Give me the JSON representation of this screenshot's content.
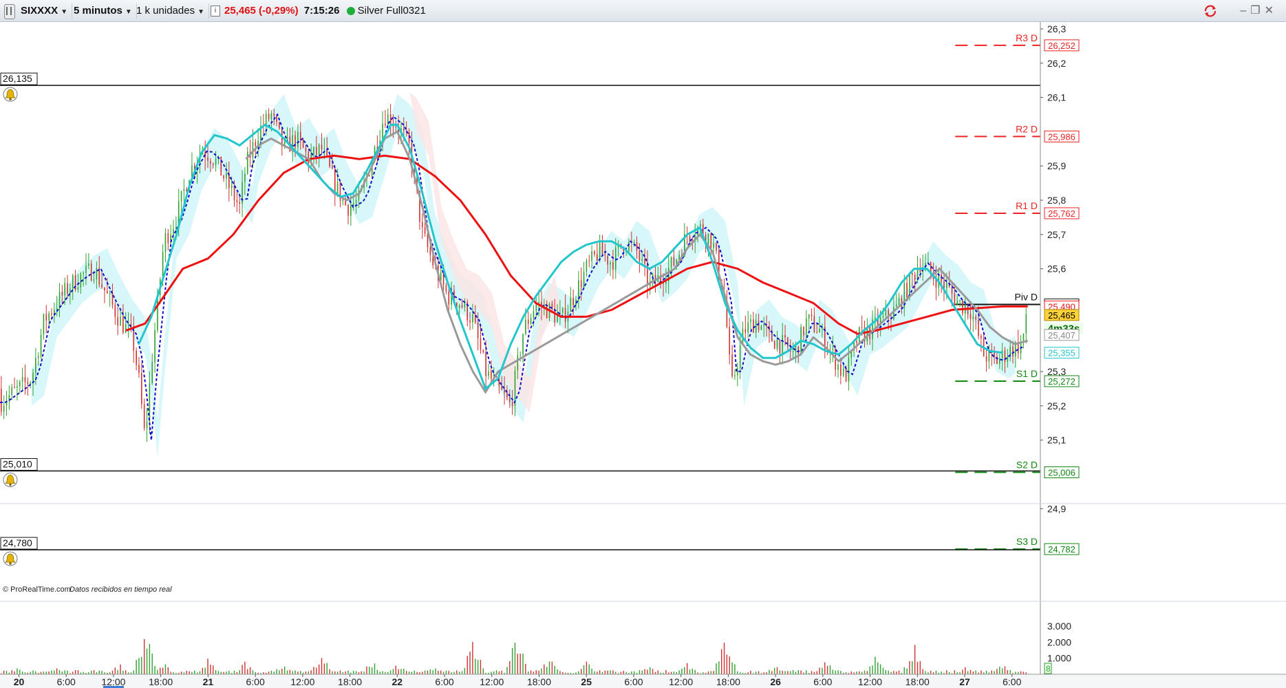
{
  "toolbar": {
    "symbol": "SIXXXX",
    "timeframe": "5 minutos",
    "units": "1 k unidades",
    "price_change": "25,465 (-0,29%)",
    "time": "7:15:26",
    "account": "Silver Full0321"
  },
  "colors": {
    "up_candle": "#2fa12f",
    "down_candle": "#d03030",
    "ma_red": "#ee1111",
    "ma_cyan": "#22c6cc",
    "ma_gray": "#9a9a9a",
    "dotted_blue": "#1010cc",
    "cloud_cyan": "#c8f4f8",
    "cloud_pink": "#fbe3e3",
    "resistance": "#ee2222",
    "support": "#118811",
    "current_price_bg": "#ffd23a"
  },
  "footer": {
    "copyright": "© ProRealTime.com",
    "status": "Datos recibidos en tiempo real"
  },
  "chart_data": {
    "type": "candlestick",
    "y_axis": {
      "ylim": [
        24.73,
        26.32
      ],
      "ticks": [
        "26,3",
        "26,2",
        "26,1",
        "25,9",
        "25,8",
        "25,7",
        "25,6",
        "25,3",
        "25,2",
        "25,1",
        "24,9"
      ],
      "tick_values": [
        26.3,
        26.2,
        26.1,
        25.9,
        25.8,
        25.7,
        25.6,
        25.3,
        25.2,
        25.1,
        24.9
      ]
    },
    "x_axis": {
      "ticks": [
        {
          "label": "20",
          "x": 0.0,
          "bold": true
        },
        {
          "label": "6:00",
          "x": 0.075,
          "bold": false
        },
        {
          "label": "12:00",
          "x": 0.15,
          "bold": false
        },
        {
          "label": "18:00",
          "x": 0.225,
          "bold": false
        },
        {
          "label": "21",
          "x": 0.3,
          "bold": true
        },
        {
          "label": "6:00",
          "x": 0.375,
          "bold": false
        },
        {
          "label": "12:00",
          "x": 0.45,
          "bold": false
        },
        {
          "label": "18:00",
          "x": 0.525,
          "bold": false
        },
        {
          "label": "22",
          "x": 0.6,
          "bold": true
        },
        {
          "label": "6:00",
          "x": 0.675,
          "bold": false
        },
        {
          "label": "12:00",
          "x": 0.75,
          "bold": false
        },
        {
          "label": "18:00",
          "x": 0.825,
          "bold": false
        },
        {
          "label": "25",
          "x": 0.9,
          "bold": true
        },
        {
          "label": "6:00",
          "x": 0.975,
          "bold": false
        },
        {
          "label": "12:00",
          "x": 1.05,
          "bold": false
        },
        {
          "label": "18:00",
          "x": 1.125,
          "bold": false
        },
        {
          "label": "26",
          "x": 1.2,
          "bold": true
        },
        {
          "label": "6:00",
          "x": 1.275,
          "bold": false
        },
        {
          "label": "12:00",
          "x": 1.35,
          "bold": false
        },
        {
          "label": "18:00",
          "x": 1.425,
          "bold": false
        },
        {
          "label": "27",
          "x": 1.5,
          "bold": true
        },
        {
          "label": "6:00",
          "x": 1.575,
          "bold": false
        }
      ],
      "xlim": [
        -0.03,
        1.62
      ]
    },
    "price_path": [
      [
        -0.03,
        25.21
      ],
      [
        0.0,
        25.25
      ],
      [
        0.02,
        25.28
      ],
      [
        0.04,
        25.45
      ],
      [
        0.06,
        25.5
      ],
      [
        0.08,
        25.55
      ],
      [
        0.1,
        25.58
      ],
      [
        0.12,
        25.6
      ],
      [
        0.14,
        25.52
      ],
      [
        0.16,
        25.45
      ],
      [
        0.18,
        25.4
      ],
      [
        0.19,
        25.28
      ],
      [
        0.2,
        25.1
      ],
      [
        0.21,
        25.32
      ],
      [
        0.22,
        25.5
      ],
      [
        0.23,
        25.68
      ],
      [
        0.25,
        25.75
      ],
      [
        0.27,
        25.88
      ],
      [
        0.29,
        25.95
      ],
      [
        0.31,
        25.92
      ],
      [
        0.33,
        25.85
      ],
      [
        0.35,
        25.78
      ],
      [
        0.36,
        25.9
      ],
      [
        0.38,
        26.0
      ],
      [
        0.4,
        26.05
      ],
      [
        0.42,
        25.95
      ],
      [
        0.44,
        25.98
      ],
      [
        0.46,
        25.92
      ],
      [
        0.48,
        25.95
      ],
      [
        0.5,
        25.85
      ],
      [
        0.52,
        25.78
      ],
      [
        0.54,
        25.8
      ],
      [
        0.56,
        25.92
      ],
      [
        0.58,
        26.05
      ],
      [
        0.6,
        26.02
      ],
      [
        0.62,
        25.95
      ],
      [
        0.64,
        25.7
      ],
      [
        0.66,
        25.6
      ],
      [
        0.68,
        25.52
      ],
      [
        0.7,
        25.5
      ],
      [
        0.72,
        25.45
      ],
      [
        0.74,
        25.3
      ],
      [
        0.76,
        25.25
      ],
      [
        0.78,
        25.2
      ],
      [
        0.8,
        25.42
      ],
      [
        0.82,
        25.5
      ],
      [
        0.84,
        25.48
      ],
      [
        0.86,
        25.45
      ],
      [
        0.88,
        25.52
      ],
      [
        0.9,
        25.6
      ],
      [
        0.92,
        25.65
      ],
      [
        0.94,
        25.62
      ],
      [
        0.96,
        25.68
      ],
      [
        0.98,
        25.65
      ],
      [
        1.0,
        25.55
      ],
      [
        1.02,
        25.58
      ],
      [
        1.04,
        25.62
      ],
      [
        1.06,
        25.7
      ],
      [
        1.08,
        25.72
      ],
      [
        1.1,
        25.68
      ],
      [
        1.12,
        25.5
      ],
      [
        1.13,
        25.25
      ],
      [
        1.15,
        25.42
      ],
      [
        1.17,
        25.45
      ],
      [
        1.19,
        25.4
      ],
      [
        1.21,
        25.38
      ],
      [
        1.23,
        25.35
      ],
      [
        1.25,
        25.45
      ],
      [
        1.27,
        25.42
      ],
      [
        1.29,
        25.35
      ],
      [
        1.31,
        25.28
      ],
      [
        1.33,
        25.4
      ],
      [
        1.35,
        25.42
      ],
      [
        1.37,
        25.45
      ],
      [
        1.39,
        25.48
      ],
      [
        1.41,
        25.55
      ],
      [
        1.43,
        25.62
      ],
      [
        1.45,
        25.58
      ],
      [
        1.47,
        25.55
      ],
      [
        1.49,
        25.5
      ],
      [
        1.51,
        25.48
      ],
      [
        1.53,
        25.35
      ],
      [
        1.55,
        25.33
      ],
      [
        1.57,
        25.36
      ],
      [
        1.59,
        25.38
      ],
      [
        1.6,
        25.465
      ]
    ],
    "ma_red": [
      [
        0.17,
        25.42
      ],
      [
        0.2,
        25.44
      ],
      [
        0.23,
        25.52
      ],
      [
        0.26,
        25.6
      ],
      [
        0.3,
        25.63
      ],
      [
        0.34,
        25.7
      ],
      [
        0.38,
        25.8
      ],
      [
        0.42,
        25.88
      ],
      [
        0.46,
        25.92
      ],
      [
        0.5,
        25.93
      ],
      [
        0.54,
        25.92
      ],
      [
        0.58,
        25.93
      ],
      [
        0.62,
        25.92
      ],
      [
        0.66,
        25.87
      ],
      [
        0.7,
        25.8
      ],
      [
        0.74,
        25.7
      ],
      [
        0.78,
        25.58
      ],
      [
        0.82,
        25.5
      ],
      [
        0.86,
        25.46
      ],
      [
        0.9,
        25.46
      ],
      [
        0.94,
        25.48
      ],
      [
        0.98,
        25.52
      ],
      [
        1.02,
        25.56
      ],
      [
        1.06,
        25.6
      ],
      [
        1.1,
        25.62
      ],
      [
        1.14,
        25.6
      ],
      [
        1.18,
        25.56
      ],
      [
        1.22,
        25.53
      ],
      [
        1.26,
        25.5
      ],
      [
        1.3,
        25.44
      ],
      [
        1.33,
        25.41
      ],
      [
        1.36,
        25.42
      ],
      [
        1.4,
        25.44
      ],
      [
        1.44,
        25.46
      ],
      [
        1.48,
        25.48
      ],
      [
        1.52,
        25.485
      ],
      [
        1.56,
        25.49
      ],
      [
        1.6,
        25.49
      ]
    ],
    "ma_cyan": [
      [
        0.19,
        25.38
      ],
      [
        0.21,
        25.46
      ],
      [
        0.23,
        25.58
      ],
      [
        0.25,
        25.7
      ],
      [
        0.27,
        25.84
      ],
      [
        0.29,
        25.94
      ],
      [
        0.31,
        25.99
      ],
      [
        0.33,
        25.98
      ],
      [
        0.35,
        25.96
      ],
      [
        0.37,
        25.99
      ],
      [
        0.39,
        26.02
      ],
      [
        0.41,
        26.0
      ],
      [
        0.43,
        25.96
      ],
      [
        0.45,
        25.92
      ],
      [
        0.47,
        25.88
      ],
      [
        0.49,
        25.84
      ],
      [
        0.51,
        25.81
      ],
      [
        0.53,
        25.82
      ],
      [
        0.55,
        25.88
      ],
      [
        0.57,
        25.95
      ],
      [
        0.59,
        26.02
      ],
      [
        0.6,
        26.02
      ],
      [
        0.62,
        25.95
      ],
      [
        0.64,
        25.82
      ],
      [
        0.66,
        25.68
      ],
      [
        0.68,
        25.56
      ],
      [
        0.7,
        25.45
      ],
      [
        0.72,
        25.35
      ],
      [
        0.74,
        25.25
      ],
      [
        0.76,
        25.28
      ],
      [
        0.78,
        25.38
      ],
      [
        0.8,
        25.46
      ],
      [
        0.82,
        25.52
      ],
      [
        0.84,
        25.57
      ],
      [
        0.86,
        25.62
      ],
      [
        0.88,
        25.65
      ],
      [
        0.9,
        25.67
      ],
      [
        0.92,
        25.68
      ],
      [
        0.94,
        25.68
      ],
      [
        0.96,
        25.66
      ],
      [
        0.98,
        25.62
      ],
      [
        1.0,
        25.6
      ],
      [
        1.02,
        25.62
      ],
      [
        1.04,
        25.66
      ],
      [
        1.06,
        25.7
      ],
      [
        1.08,
        25.72
      ],
      [
        1.1,
        25.62
      ],
      [
        1.12,
        25.5
      ],
      [
        1.14,
        25.42
      ],
      [
        1.16,
        25.37
      ],
      [
        1.18,
        25.34
      ],
      [
        1.2,
        25.34
      ],
      [
        1.22,
        25.36
      ],
      [
        1.24,
        25.39
      ],
      [
        1.26,
        25.38
      ],
      [
        1.28,
        25.36
      ],
      [
        1.3,
        25.35
      ],
      [
        1.32,
        25.38
      ],
      [
        1.34,
        25.42
      ],
      [
        1.36,
        25.45
      ],
      [
        1.38,
        25.5
      ],
      [
        1.4,
        25.56
      ],
      [
        1.42,
        25.6
      ],
      [
        1.44,
        25.6
      ],
      [
        1.46,
        25.56
      ],
      [
        1.48,
        25.5
      ],
      [
        1.5,
        25.44
      ],
      [
        1.52,
        25.38
      ],
      [
        1.54,
        25.36
      ],
      [
        1.56,
        25.355
      ]
    ],
    "ma_gray": [
      [
        0.36,
        25.92
      ],
      [
        0.38,
        25.96
      ],
      [
        0.4,
        25.98
      ],
      [
        0.42,
        25.96
      ],
      [
        0.44,
        25.94
      ],
      [
        0.46,
        25.92
      ],
      [
        0.48,
        25.86
      ],
      [
        0.5,
        25.82
      ],
      [
        0.52,
        25.8
      ],
      [
        0.54,
        25.82
      ],
      [
        0.56,
        25.9
      ],
      [
        0.58,
        25.98
      ],
      [
        0.6,
        26.0
      ],
      [
        0.62,
        25.92
      ],
      [
        0.64,
        25.78
      ],
      [
        0.66,
        25.62
      ],
      [
        0.68,
        25.48
      ],
      [
        0.7,
        25.38
      ],
      [
        0.72,
        25.3
      ],
      [
        0.74,
        25.24
      ],
      [
        0.76,
        25.3
      ],
      [
        1.04,
        25.6
      ],
      [
        1.06,
        25.66
      ],
      [
        1.08,
        25.7
      ],
      [
        1.1,
        25.65
      ],
      [
        1.12,
        25.52
      ],
      [
        1.14,
        25.4
      ],
      [
        1.16,
        25.35
      ],
      [
        1.18,
        25.33
      ],
      [
        1.2,
        25.32
      ],
      [
        1.22,
        25.33
      ],
      [
        1.24,
        25.35
      ],
      [
        1.26,
        25.4
      ],
      [
        1.28,
        25.37
      ],
      [
        1.3,
        25.33
      ],
      [
        1.32,
        25.36
      ],
      [
        1.46,
        25.6
      ],
      [
        1.48,
        25.56
      ],
      [
        1.5,
        25.52
      ],
      [
        1.52,
        25.48
      ],
      [
        1.54,
        25.43
      ],
      [
        1.56,
        25.4
      ],
      [
        1.58,
        25.38
      ],
      [
        1.6,
        25.39
      ]
    ],
    "levels": [
      {
        "name": "R3 D",
        "label": "26,252",
        "value": 26.252,
        "kind": "resistance",
        "x_start": 1.485
      },
      {
        "name": "R2 D",
        "label": "25,986",
        "value": 25.986,
        "kind": "resistance",
        "x_start": 1.485
      },
      {
        "name": "R1 D",
        "label": "25,762",
        "value": 25.762,
        "kind": "resistance",
        "x_start": 1.485
      },
      {
        "name": "Piv D",
        "label": "25,496",
        "value": 25.496,
        "kind": "pivot",
        "x_start": 1.485
      },
      {
        "name": "S1 D",
        "label": "25,272",
        "value": 25.272,
        "kind": "support",
        "x_start": 1.485
      },
      {
        "name": "S2 D",
        "label": "25,006",
        "value": 25.006,
        "kind": "support",
        "x_start": 1.485
      },
      {
        "name": "S3 D",
        "label": "24,782",
        "value": 24.782,
        "kind": "support",
        "x_start": 1.485
      }
    ],
    "alert_lines": [
      {
        "label": "26,135",
        "value": 26.135
      },
      {
        "label": "25,010",
        "value": 25.01
      },
      {
        "label": "24,780",
        "value": 24.78
      }
    ],
    "right_labels": [
      {
        "label": "25,490",
        "value": 25.49,
        "kind": "red"
      },
      {
        "label": "25,465",
        "value": 25.465,
        "kind": "current"
      },
      {
        "label": "4m33s",
        "value": 25.426,
        "kind": "timer"
      },
      {
        "label": "25,407",
        "value": 25.407,
        "kind": "gray"
      },
      {
        "label": "25,355",
        "value": 25.355,
        "kind": "cyan"
      }
    ],
    "volume": {
      "ticks": [
        "3.000",
        "2.000",
        "1.000"
      ],
      "tick_values": [
        3000,
        2000,
        1000
      ],
      "ylim": [
        0,
        3600
      ],
      "last_label": "8",
      "spikes": [
        [
          0.0,
          500
        ],
        [
          0.06,
          400
        ],
        [
          0.16,
          700
        ],
        [
          0.2,
          3100
        ],
        [
          0.23,
          800
        ],
        [
          0.3,
          1000
        ],
        [
          0.36,
          900
        ],
        [
          0.42,
          800
        ],
        [
          0.48,
          1600
        ],
        [
          0.56,
          900
        ],
        [
          0.6,
          800
        ],
        [
          0.66,
          600
        ],
        [
          0.72,
          2400
        ],
        [
          0.79,
          2700
        ],
        [
          0.84,
          1200
        ],
        [
          0.9,
          800
        ],
        [
          1.0,
          600
        ],
        [
          1.06,
          900
        ],
        [
          1.12,
          2800
        ],
        [
          1.2,
          600
        ],
        [
          1.28,
          1100
        ],
        [
          1.36,
          1300
        ],
        [
          1.42,
          2100
        ],
        [
          1.5,
          500
        ],
        [
          1.56,
          700
        ],
        [
          1.6,
          200
        ]
      ]
    }
  }
}
